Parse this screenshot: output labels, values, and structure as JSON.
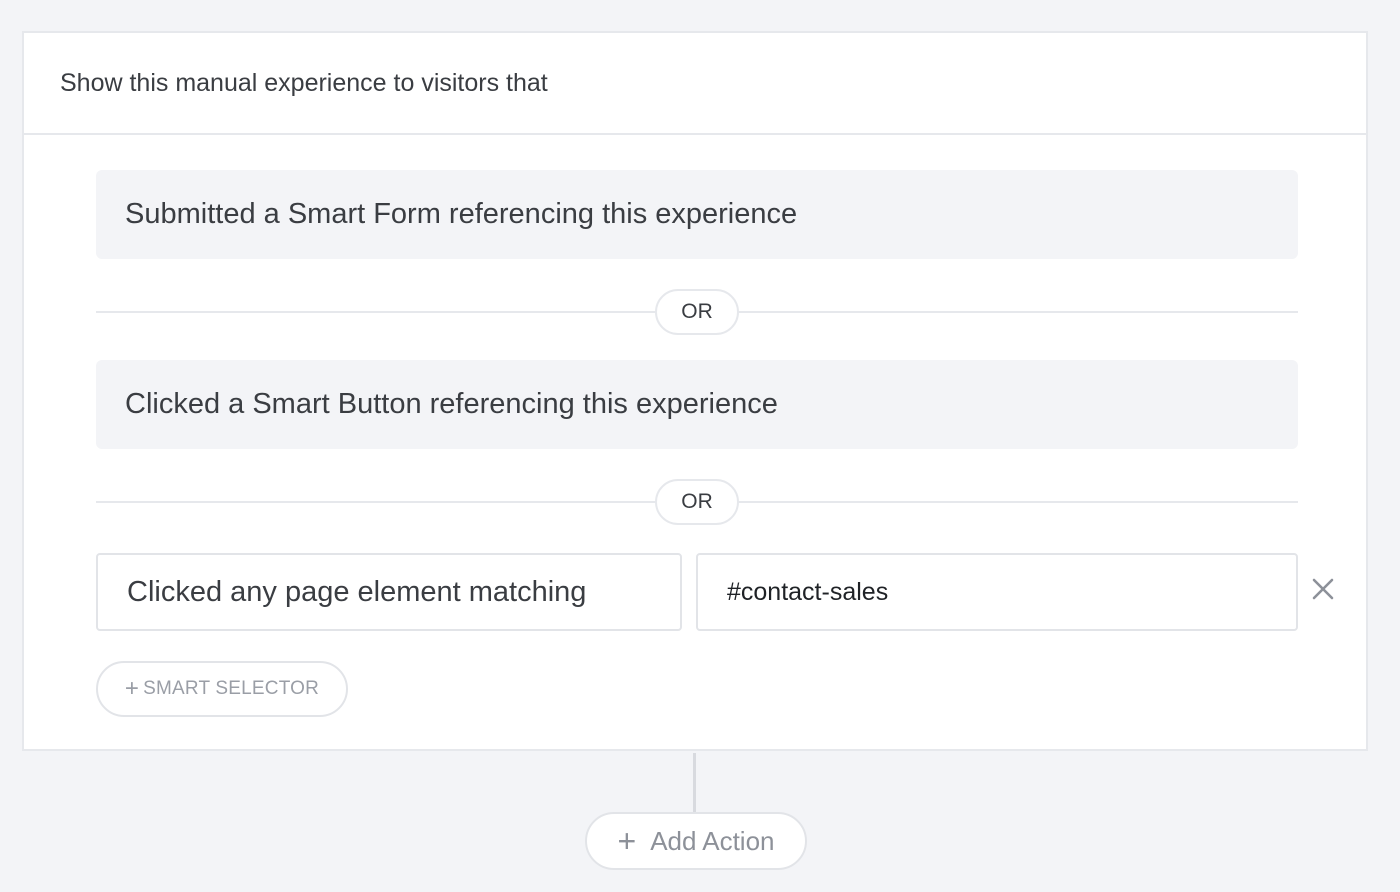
{
  "card": {
    "header_text": "Show this manual experience to visitors that"
  },
  "conditions": [
    {
      "label": "Submitted a Smart Form referencing this experience"
    },
    {
      "label": "Clicked a Smart Button referencing this experience"
    }
  ],
  "or_label": "OR",
  "selector_condition": {
    "type_label": "Clicked any page element matching",
    "value": "#contact-sales"
  },
  "smart_selector_button": {
    "plus": "+",
    "label": "SMART SELECTOR"
  },
  "add_action_button": {
    "plus": "+",
    "label": "Add Action"
  },
  "icons": {
    "remove": "close-icon"
  },
  "colors": {
    "background": "#f3f4f7",
    "card": "#ffffff",
    "border": "#e6e8ec",
    "text": "#3a3d42",
    "muted": "#9a9ea6"
  }
}
